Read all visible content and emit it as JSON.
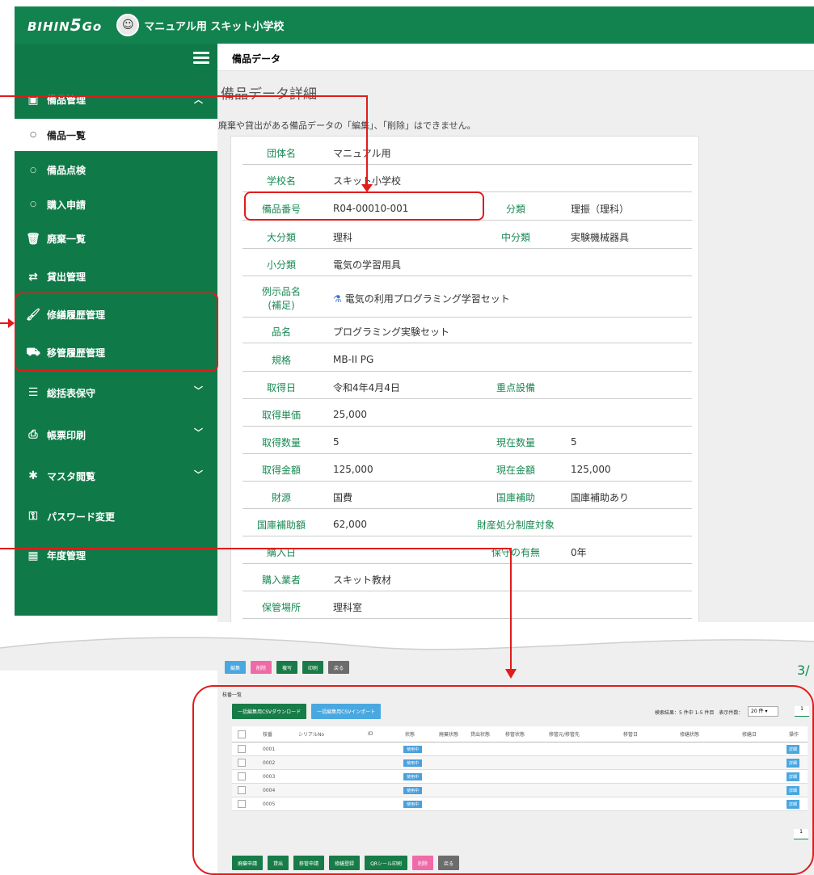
{
  "header": {
    "logo_prefix": "BIHIN",
    "logo_num": "5",
    "logo_suffix": "Go",
    "school": "マニュアル用 スキット小学校"
  },
  "sidebar": {
    "items": [
      {
        "label": "備品管理",
        "icon": "box-icon",
        "chev": "︿"
      },
      {
        "label": "備品一覧",
        "icon": "circle-bullet-icon"
      },
      {
        "label": "備品点検",
        "icon": "circle-bullet-icon"
      },
      {
        "label": "購入申請",
        "icon": "circle-bullet-icon"
      },
      {
        "label": "廃棄一覧",
        "icon": "trash-icon"
      },
      {
        "label": "貸出管理",
        "icon": "swap-icon"
      },
      {
        "label": "修繕履歴管理",
        "icon": "wrench-icon"
      },
      {
        "label": "移管履歴管理",
        "icon": "cart-icon"
      },
      {
        "label": "総括表保守",
        "icon": "list-icon",
        "chev": "﹀"
      },
      {
        "label": "帳票印刷",
        "icon": "printer-icon",
        "chev": "﹀"
      },
      {
        "label": "マスタ閲覧",
        "icon": "gear-icon",
        "chev": "﹀"
      },
      {
        "label": "パスワード変更",
        "icon": "key-icon"
      },
      {
        "label": "年度管理",
        "icon": "calendar-icon"
      }
    ]
  },
  "breadcrumb": "備品データ",
  "page": {
    "title": "備品データ詳細",
    "note": "廃棄や貸出がある備品データの「編集」、「削除」はできません。"
  },
  "detail": {
    "rows": [
      {
        "l": "団体名",
        "v": "マニュアル用"
      },
      {
        "l": "学校名",
        "v": "スキット小学校"
      },
      {
        "l": "備品番号",
        "v": "R04-00010-001",
        "l2": "分類",
        "v2": "理振（理科）"
      },
      {
        "l": "大分類",
        "v": "理科",
        "l2": "中分類",
        "v2": "実験機械器具"
      },
      {
        "l": "小分類",
        "v": "電気の学習用具"
      },
      {
        "l": "例示品名\n(補足)",
        "v": "電気の利用プログラミング学習セット"
      },
      {
        "l": "品名",
        "v": "プログラミング実験セット"
      },
      {
        "l": "規格",
        "v": "MB-II PG"
      },
      {
        "l": "取得日",
        "v": "令和4年4月4日",
        "l2": "重点設備",
        "v2": ""
      },
      {
        "l": "取得単価",
        "v": "25,000"
      },
      {
        "l": "取得数量",
        "v": "5",
        "l2": "現在数量",
        "v2": "5"
      },
      {
        "l": "取得金額",
        "v": "125,000",
        "l2": "現在金額",
        "v2": "125,000"
      },
      {
        "l": "財源",
        "v": "国費",
        "l2": "国庫補助",
        "v2": "国庫補助あり"
      },
      {
        "l": "国庫補助額",
        "v": "62,000",
        "l2": "財産処分制度対象",
        "v2": ""
      },
      {
        "l": "購入日",
        "v": "",
        "l2": "保守の有無",
        "v2": "0年"
      },
      {
        "l": "購入業者",
        "v": "スキット教材"
      },
      {
        "l": "保管場所",
        "v": "理科室"
      }
    ]
  },
  "actions": {
    "edit": "編集",
    "delete": "削除",
    "copy": "複写",
    "print": "印刷",
    "back": "戻る"
  },
  "page_num": "3/",
  "list": {
    "title": "枝番一覧",
    "csv_download": "一括編集用CSVダウンロード",
    "csv_import": "一括編集用CSVインポート",
    "result": "検索結果：5 件中 1-5 件目　表示件数：",
    "per_page": "20 件",
    "page": "1",
    "headers": [
      "枝番",
      "シリアルNo",
      "ID",
      "状態",
      "廃棄状態",
      "貸出状態",
      "移管状態",
      "移管元/移管先",
      "移管日",
      "修繕状態",
      "修繕日",
      "操作"
    ],
    "rows": [
      {
        "no": "0001",
        "status": "使用中",
        "op": "詳細"
      },
      {
        "no": "0002",
        "status": "使用中",
        "op": "詳細"
      },
      {
        "no": "0003",
        "status": "使用中",
        "op": "詳細"
      },
      {
        "no": "0004",
        "status": "使用中",
        "op": "詳細"
      },
      {
        "no": "0005",
        "status": "使用中",
        "op": "詳細"
      }
    ],
    "footer": {
      "dispose": "廃棄申請",
      "lend": "貸出",
      "transfer": "移管申請",
      "repair": "修繕登録",
      "qr": "QRシール印刷",
      "delete": "削除",
      "back": "戻る"
    }
  }
}
